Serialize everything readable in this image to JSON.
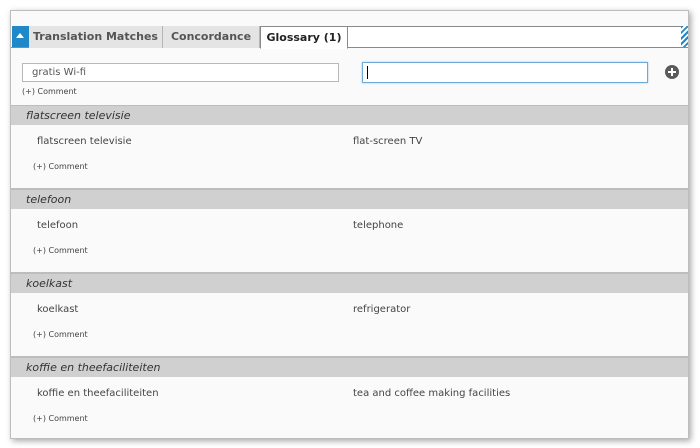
{
  "tabs": [
    {
      "label": "Translation Matches"
    },
    {
      "label": "Concordance"
    },
    {
      "label": "Glossary (1)"
    }
  ],
  "active_tab": "Glossary (1)",
  "entry": {
    "term_value": "gratis Wi-fi",
    "translation_value": "",
    "comment_label": "(+) Comment",
    "add_icon": "plus-circle-icon",
    "collapse_icon": "triangle-up-icon"
  },
  "glossary": [
    {
      "header": "flatscreen televisie",
      "source": "flatscreen televisie",
      "target": "flat-screen TV",
      "comment_label": "(+) Comment"
    },
    {
      "header": "telefoon",
      "source": "telefoon",
      "target": "telephone",
      "comment_label": "(+) Comment"
    },
    {
      "header": "koelkast",
      "source": "koelkast",
      "target": "refrigerator",
      "comment_label": "(+) Comment"
    },
    {
      "header": "koffie en theefaciliteiten",
      "source": "koffie en theefaciliteiten",
      "target": "tea and coffee making facilities",
      "comment_label": "(+) Comment"
    }
  ],
  "colors": {
    "accent": "#1f88c8",
    "header_bg": "#d0d0d0",
    "panel_bg": "#fafafa"
  }
}
